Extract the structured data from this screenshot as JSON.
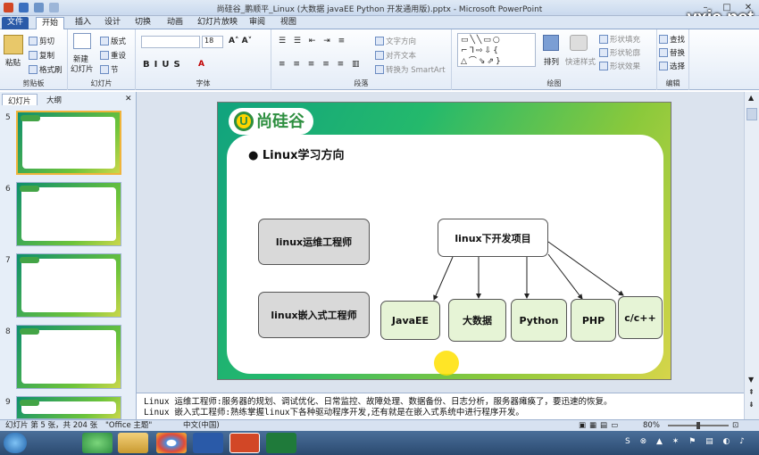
{
  "window": {
    "title": "尚硅谷_鹏顺平_Linux (大数据 javaEE Python 开发通用版).pptx - Microsoft PowerPoint",
    "watermark": "vxia.net"
  },
  "tabs": [
    "文件",
    "开始",
    "插入",
    "设计",
    "切换",
    "动画",
    "幻灯片放映",
    "审阅",
    "视图"
  ],
  "ribbon": {
    "clipboard": {
      "label": "剪贴板",
      "paste": "粘贴",
      "cut": "剪切",
      "copy": "复制",
      "format": "格式刷"
    },
    "slides": {
      "label": "幻灯片",
      "new": "新建",
      "new2": "幻灯片",
      "layout": "版式",
      "reset": "重设",
      "section": "节"
    },
    "font": {
      "label": "字体",
      "size": "18"
    },
    "paragraph": {
      "label": "段落",
      "dir": "文字方向",
      "align": "对齐文本",
      "smart": "转换为 SmartArt"
    },
    "drawing": {
      "label": "绘图",
      "arrange": "排列",
      "quick": "快速样式",
      "fill": "形状填充",
      "outline": "形状轮廓",
      "effect": "形状效果"
    },
    "editing": {
      "label": "编辑",
      "find": "查找",
      "replace": "替换",
      "select": "选择"
    }
  },
  "panel": {
    "tabs": [
      "幻灯片",
      "大纲"
    ],
    "nums": [
      "5",
      "6",
      "7",
      "8",
      "9"
    ]
  },
  "slide": {
    "logo": "尚硅谷",
    "logo_u": "U",
    "bullet": "Linux学习方向",
    "nodes": {
      "ops": "linux运维工程师",
      "embed": "linux嵌入式工程师",
      "dev": "linux下开发项目",
      "javaee": "JavaEE",
      "bigdata": "大数据",
      "python": "Python",
      "php": "PHP",
      "cpp": "c/c++"
    }
  },
  "notes": [
    "Linux 运维工程师:服务器的规划、调试优化、日常监控、故障处理、数据备份、日志分析，服务器瘫痪了，要迅速的恢复。",
    "Linux 嵌入式工程师:熟练掌握linux下各种驱动程序开发,还有就是在嵌入式系统中进行程序开发。"
  ],
  "status": {
    "slide": "幻灯片 第 5 张，共 204 张",
    "theme": "\"Office 主题\"",
    "lang": "中文(中国)",
    "zoom": "80%"
  },
  "colors": {
    "accent": "#2a5aa8",
    "slide_green": "#24b96c"
  }
}
